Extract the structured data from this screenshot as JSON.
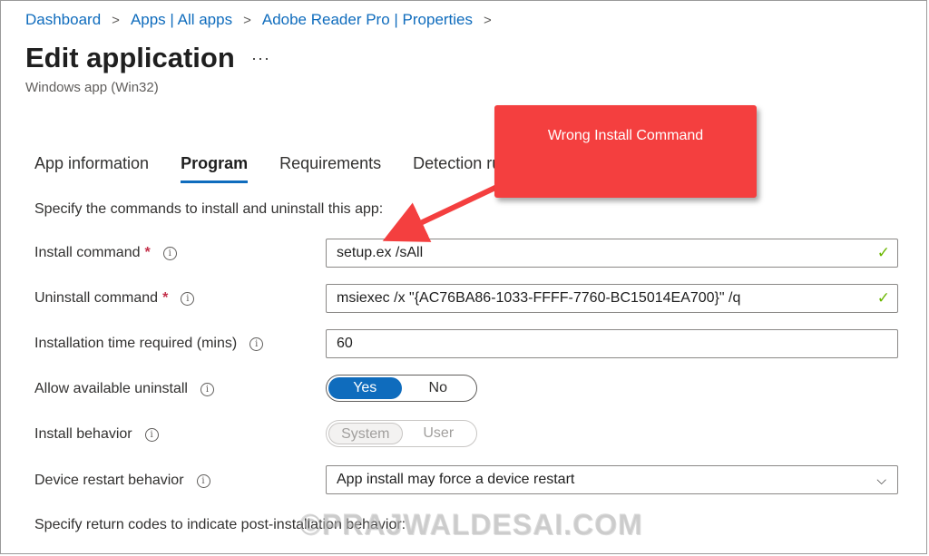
{
  "breadcrumb": {
    "items": [
      "Dashboard",
      "Apps | All apps",
      "Adobe Reader Pro | Properties"
    ]
  },
  "header": {
    "title": "Edit application",
    "more": "···",
    "subtitle": "Windows app (Win32)"
  },
  "tabs": [
    {
      "label": "App information",
      "active": false
    },
    {
      "label": "Program",
      "active": true
    },
    {
      "label": "Requirements",
      "active": false
    },
    {
      "label": "Detection ru",
      "active": false
    }
  ],
  "program": {
    "intro": "Specify the commands to install and uninstall this app:",
    "install_command": {
      "label": "Install command",
      "required": "*",
      "value": "setup.ex /sAll"
    },
    "uninstall_command": {
      "label": "Uninstall command",
      "required": "*",
      "value": "msiexec /x \"{AC76BA86-1033-FFFF-7760-BC15014EA700}\" /q"
    },
    "install_time": {
      "label": "Installation time required (mins)",
      "value": "60"
    },
    "allow_uninstall": {
      "label": "Allow available uninstall",
      "options": [
        "Yes",
        "No"
      ],
      "selected": "Yes"
    },
    "install_behavior": {
      "label": "Install behavior",
      "options": [
        "System",
        "User"
      ],
      "selected": "System"
    },
    "restart_behavior": {
      "label": "Device restart behavior",
      "value": "App install may force a device restart"
    },
    "return_codes_text": "Specify return codes to indicate post-installation behavior:"
  },
  "icons": {
    "info": "i",
    "check": "✓",
    "chevron_down": "⌵",
    "breadcrumb_sep": ">"
  },
  "annotation": {
    "callout_text": "Wrong Install Command"
  },
  "watermark": "©PRAJWALDESAI.COM",
  "colors": {
    "accent": "#0f6cbd",
    "required": "#c4314b",
    "valid_check": "#6bb700",
    "callout": "#f43f3f"
  }
}
